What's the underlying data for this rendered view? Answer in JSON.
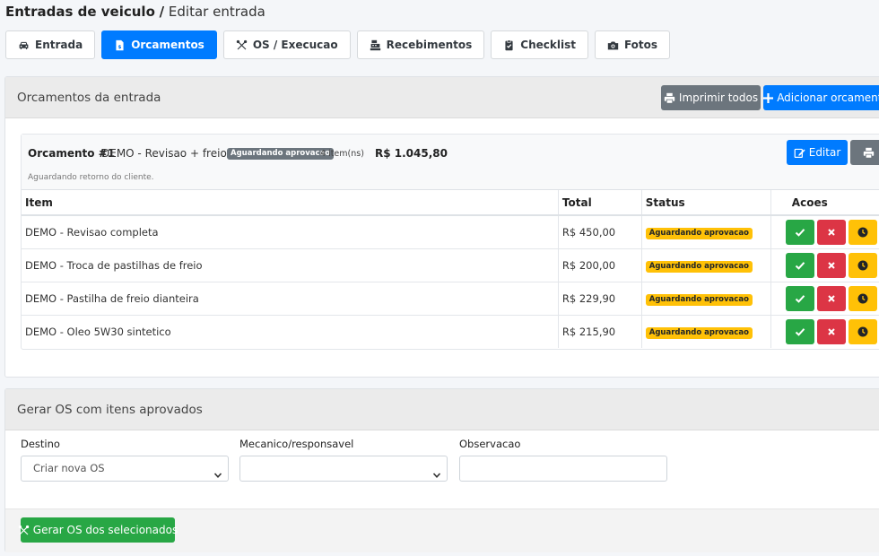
{
  "page": {
    "title": "Entradas de veiculo",
    "separator": "/",
    "subtitle": "Editar entrada"
  },
  "tabs": [
    {
      "label": "Entrada",
      "icon": "car-icon",
      "active": false
    },
    {
      "label": "Orcamentos",
      "icon": "invoice-icon",
      "active": true
    },
    {
      "label": "OS / Execucao",
      "icon": "tools-icon",
      "active": false
    },
    {
      "label": "Recebimentos",
      "icon": "cash-register-icon",
      "active": false
    },
    {
      "label": "Checklist",
      "icon": "clipboard-check-icon",
      "active": false
    },
    {
      "label": "Fotos",
      "icon": "camera-icon",
      "active": false
    }
  ],
  "orcamentos_card": {
    "title": "Orcamentos da entrada",
    "print_all_label": "Imprimir todos",
    "add_label": "Adicionar orcamento"
  },
  "orcamento": {
    "name": "Orcamento #1",
    "description": "DEMO - Revisao + freios",
    "status": "Aguardando aprovacao",
    "item_count": "4 item(ns)",
    "total": "R$ 1.045,80",
    "note": "Aguardando retorno do cliente.",
    "edit_label": "Editar",
    "columns": [
      "Item",
      "Total",
      "Status",
      "Acoes"
    ],
    "items": [
      {
        "name": "DEMO - Revisao completa",
        "total": "R$ 450,00",
        "status": "Aguardando aprovacao"
      },
      {
        "name": "DEMO - Troca de pastilhas de freio",
        "total": "R$ 200,00",
        "status": "Aguardando aprovacao"
      },
      {
        "name": "DEMO - Pastilha de freio dianteira",
        "total": "R$ 229,90",
        "status": "Aguardando aprovacao"
      },
      {
        "name": "DEMO - Oleo 5W30 sintetico",
        "total": "R$ 215,90",
        "status": "Aguardando aprovacao"
      }
    ]
  },
  "gerar_os": {
    "title": "Gerar OS com itens aprovados",
    "destino_label": "Destino",
    "destino_value": "Criar nova OS",
    "mecanico_label": "Mecanico/responsavel",
    "mecanico_value": "",
    "observacao_label": "Observacao",
    "observacao_value": "",
    "submit_label": "Gerar OS dos selecionados"
  },
  "colors": {
    "primary": "#007bff",
    "success": "#28a745",
    "danger": "#dc3545",
    "warning": "#ffc107",
    "secondary": "#6c757d"
  }
}
